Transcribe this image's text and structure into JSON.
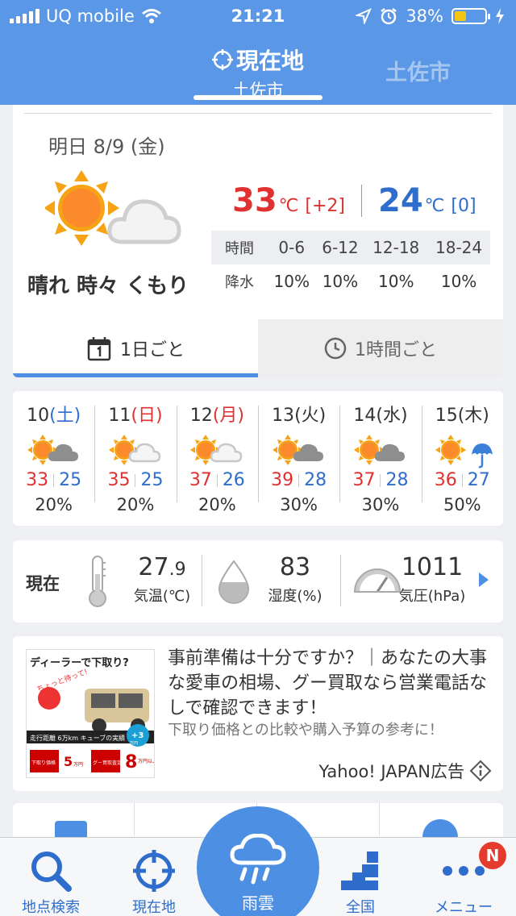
{
  "status_bar": {
    "carrier": "UQ mobile",
    "time": "21:21",
    "battery": "38%",
    "battery_level": 0.38
  },
  "header": {
    "current_label": "現在地",
    "current_city": "土佐市",
    "other_city": "土佐市"
  },
  "tomorrow": {
    "date": "明日 8/9 (金)",
    "icon": "sun-with-cloud",
    "weather_text": "晴れ 時々 くもり",
    "high": "33",
    "high_unit": "℃",
    "high_diff": "[+2]",
    "low": "24",
    "low_unit": "℃",
    "low_diff": "[0]",
    "rain_table": {
      "time_label": "時間",
      "slots": [
        "0-6",
        "6-12",
        "12-18",
        "18-24"
      ],
      "rain_label": "降水",
      "values": [
        "10%",
        "10%",
        "10%",
        "10%"
      ]
    }
  },
  "tabs": [
    {
      "label": "1日ごと",
      "icon": "calendar-icon",
      "active": true
    },
    {
      "label": "1時間ごと",
      "icon": "clock-icon",
      "active": false
    }
  ],
  "weekly": [
    {
      "num": "10",
      "dow": "(土)",
      "dow_class": "sat",
      "icon": "sun-cloud",
      "high": "33",
      "low": "25",
      "rain": "20%"
    },
    {
      "num": "11",
      "dow": "(日)",
      "dow_class": "sun",
      "icon": "sun-cloud-light",
      "high": "35",
      "low": "25",
      "rain": "20%"
    },
    {
      "num": "12",
      "dow": "(月)",
      "dow_class": "sun",
      "icon": "sun-cloud-light",
      "high": "37",
      "low": "26",
      "rain": "20%"
    },
    {
      "num": "13",
      "dow": "(火)",
      "dow_class": "",
      "icon": "sun-cloud",
      "high": "39",
      "low": "28",
      "rain": "30%"
    },
    {
      "num": "14",
      "dow": "(水)",
      "dow_class": "",
      "icon": "sun-cloud",
      "high": "37",
      "low": "28",
      "rain": "30%"
    },
    {
      "num": "15",
      "dow": "(木)",
      "dow_class": "",
      "icon": "sun-umbrella",
      "high": "36",
      "low": "27",
      "rain": "50%"
    }
  ],
  "current": {
    "label": "現在",
    "temp_int": "27",
    "temp_dec": ".9",
    "temp_caption": "気温(℃)",
    "humidity": "83",
    "humidity_caption": "湿度(%)",
    "pressure": "1011",
    "pressure_caption": "気圧(hPa)"
  },
  "ad": {
    "text": "事前準備は十分ですか？｜あなたの大事な愛車の相場、グー買取なら営業電話なしで確認できます！",
    "sub": "下取り価格との比較や購入予算の参考に！",
    "source": "Yahoo! JAPAN広告",
    "image_text": {
      "headline": "ディーラーで下取り?",
      "bubble": "ちょっと待って!",
      "mileage": "走行距離 6万km キューブの実績",
      "plus": "+3",
      "plus_unit": "万円",
      "dealer_label": "下取り価格",
      "dealer_value": "5",
      "dealer_unit": "万円",
      "goo_label": "グー買取査定額",
      "goo_value": "8",
      "goo_unit": "万円以上"
    }
  },
  "bottom_nav": [
    {
      "label": "地点検索",
      "icon": "search-icon"
    },
    {
      "label": "現在地",
      "icon": "crosshair-icon"
    },
    {
      "label": "雨雲",
      "icon": "rain-cloud-icon"
    },
    {
      "label": "全国",
      "icon": "japan-map-icon"
    },
    {
      "label": "メニュー",
      "icon": "more-icon"
    }
  ],
  "menu_badge": "N",
  "colors": {
    "header_bg": "#5a97e6",
    "accent": "#4d8fe2",
    "high": "#e03030",
    "low": "#2f6dcc"
  }
}
